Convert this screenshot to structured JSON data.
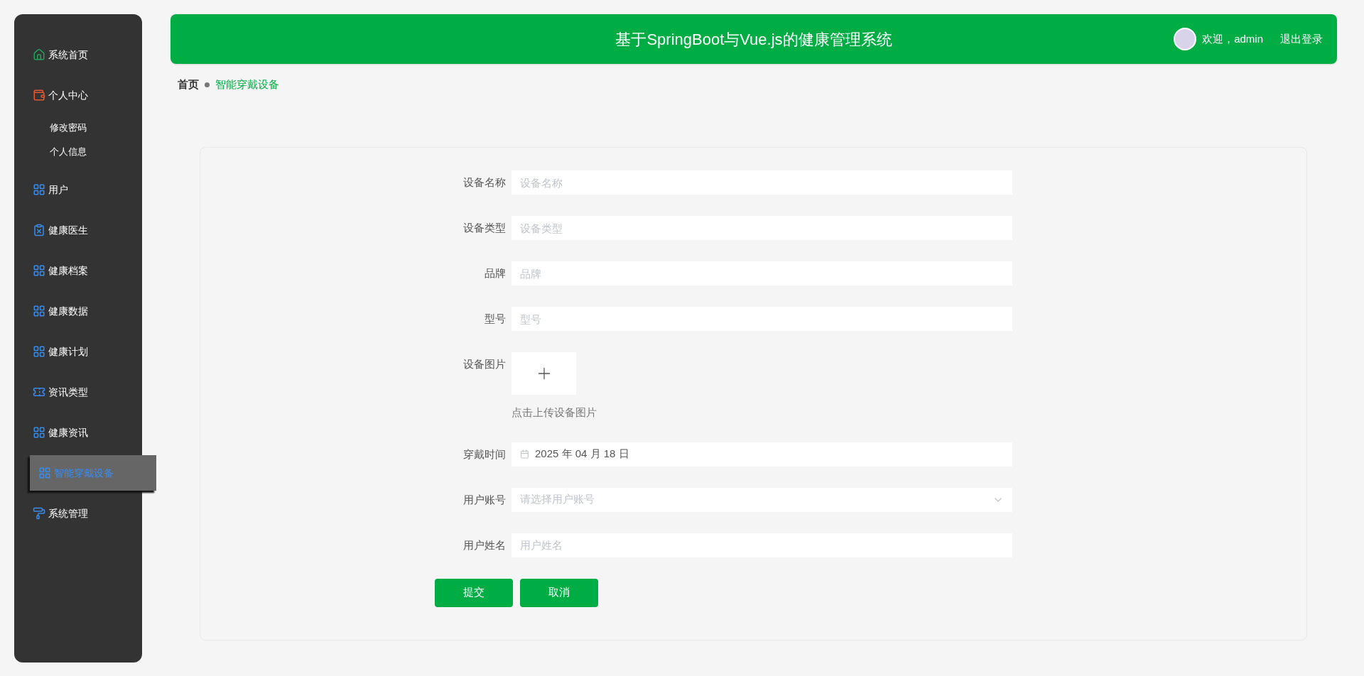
{
  "sidebar": {
    "items": [
      {
        "label": "系统首页",
        "selected": false
      },
      {
        "label": "个人中心",
        "selected": false,
        "children": [
          {
            "label": "修改密码",
            "selected": false
          },
          {
            "label": "个人信息",
            "selected": false
          }
        ]
      },
      {
        "label": "用户",
        "selected": false
      },
      {
        "label": "健康医生",
        "selected": false
      },
      {
        "label": "健康档案",
        "selected": false
      },
      {
        "label": "健康数据",
        "selected": false
      },
      {
        "label": "健康计划",
        "selected": false
      },
      {
        "label": "资讯类型",
        "selected": false
      },
      {
        "label": "健康资讯",
        "selected": false
      },
      {
        "label": "智能穿戴设备",
        "selected": true
      },
      {
        "label": "系统管理",
        "selected": false
      }
    ]
  },
  "header": {
    "title": "基于SpringBoot与Vue.js的健康管理系统",
    "greeting": "欢迎，admin",
    "logout": "退出登录"
  },
  "breadcrumb": [
    {
      "label": "首页",
      "selected": false
    },
    {
      "label": "智能穿戴设备",
      "selected": true
    }
  ],
  "form": {
    "fields": [
      {
        "kind": "text",
        "label": "设备名称",
        "placeholder": "设备名称"
      },
      {
        "kind": "text",
        "label": "设备类型",
        "placeholder": "设备类型"
      },
      {
        "kind": "text",
        "label": "品牌",
        "placeholder": "品牌"
      },
      {
        "kind": "text",
        "label": "型号",
        "placeholder": "型号"
      },
      {
        "kind": "upload",
        "label": "设备图片",
        "hint": "点击上传设备图片"
      },
      {
        "kind": "date",
        "label": "穿戴时间",
        "value": "2025 年 04 月 18 日"
      },
      {
        "kind": "select",
        "label": "用户账号",
        "placeholder": "请选择用户账号"
      },
      {
        "kind": "text",
        "label": "用户姓名",
        "placeholder": "用户姓名"
      }
    ],
    "buttons": [
      "提交",
      "取消"
    ]
  }
}
